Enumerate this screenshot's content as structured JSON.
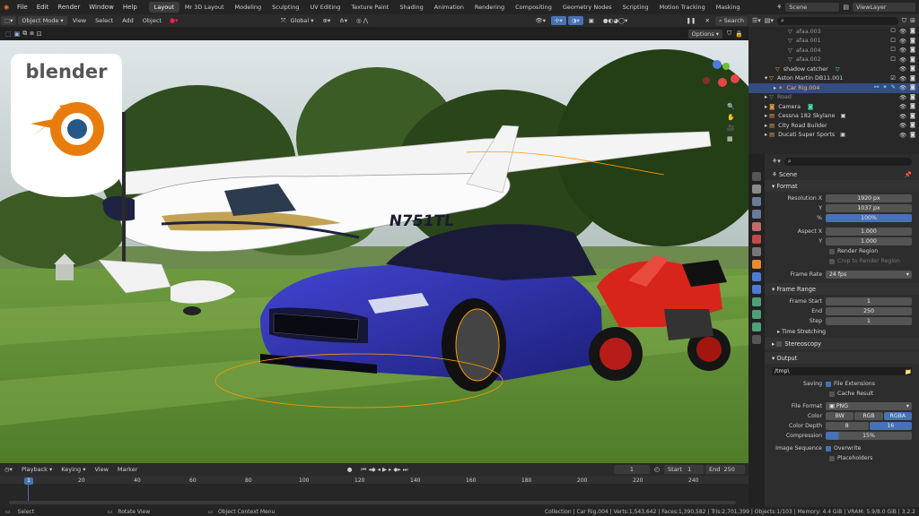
{
  "menubar": {
    "menus": [
      "File",
      "Edit",
      "Render",
      "Window",
      "Help"
    ],
    "workspaces": [
      "Layout",
      "Mr 3D Layout",
      "Modeling",
      "Sculpting",
      "UV Editing",
      "Texture Paint",
      "Shading",
      "Animation",
      "Rendering",
      "Compositing",
      "Geometry Nodes",
      "Scripting",
      "Motion Tracking",
      "Masking"
    ],
    "active_workspace": "Layout",
    "scene": "Scene",
    "view_layer": "ViewLayer"
  },
  "viewport_header": {
    "mode": "Object Mode",
    "menus": [
      "View",
      "Select",
      "Add",
      "Object"
    ],
    "transform": "Global",
    "search_label": "Search",
    "options": "Options"
  },
  "logo_text": "blender",
  "aircraft_registration": "N751TL",
  "outliner": {
    "rows": [
      {
        "label": "afaa.003",
        "indent": 3
      },
      {
        "label": "afaa.001",
        "indent": 3
      },
      {
        "label": "afaa.004",
        "indent": 3
      },
      {
        "label": "afaa.002",
        "indent": 3
      },
      {
        "label": "shadow catcher",
        "indent": 2
      },
      {
        "label": "Aston Martin DB11.001",
        "indent": 1
      },
      {
        "label": "Car Rig.004",
        "indent": 2,
        "selected": true
      },
      {
        "label": "Road",
        "indent": 1
      },
      {
        "label": "Camera",
        "indent": 1
      },
      {
        "label": "Cessna 182 Skylane",
        "indent": 1
      },
      {
        "label": "City Road Builder",
        "indent": 1
      },
      {
        "label": "Ducati Super Sports",
        "indent": 1
      }
    ]
  },
  "properties": {
    "scene_label": "Scene",
    "format": {
      "title": "Format",
      "resolution_x_label": "Resolution X",
      "resolution_x": "1920 px",
      "y_label": "Y",
      "resolution_y": "1037 px",
      "pct_label": "%",
      "pct": "100%",
      "aspect_x_label": "Aspect X",
      "aspect_x": "1.000",
      "aspect_y_label": "Y",
      "aspect_y": "1.000",
      "render_region": "Render Region",
      "crop": "Crop to Render Region",
      "frame_rate_label": "Frame Rate",
      "frame_rate": "24 fps"
    },
    "frame_range": {
      "title": "Frame Range",
      "start_label": "Frame Start",
      "start": "1",
      "end_label": "End",
      "end": "250",
      "step_label": "Step",
      "step": "1",
      "time_stretching": "Time Stretching"
    },
    "stereoscopy": "Stereoscopy",
    "output": {
      "title": "Output",
      "path": "/tmp\\",
      "saving_label": "Saving",
      "file_extensions": "File Extensions",
      "cache_result": "Cache Result",
      "file_format_label": "File Format",
      "file_format": "PNG",
      "color_label": "Color",
      "color_options": [
        "BW",
        "RGB",
        "RGBA"
      ],
      "color_selected": "RGBA",
      "depth_label": "Color Depth",
      "depth_options": [
        "8",
        "16"
      ],
      "depth_selected": "16",
      "compression_label": "Compression",
      "compression": "15%",
      "image_sequence_label": "Image Sequence",
      "overwrite": "Overwrite",
      "placeholders": "Placeholders"
    }
  },
  "timeline": {
    "menus": [
      "Playback",
      "Keying",
      "View",
      "Marker"
    ],
    "current_frame": "1",
    "start_label": "Start",
    "start": "1",
    "end_label": "End",
    "end": "250",
    "ticks": [
      "1",
      "20",
      "40",
      "60",
      "80",
      "100",
      "120",
      "140",
      "160",
      "180",
      "200",
      "220",
      "240"
    ]
  },
  "statusbar": {
    "left": [
      "Select",
      "Rotate View",
      "Object Context Menu"
    ],
    "right": "Collection | Car Rig.004 | Verts:1,543,642 | Faces:1,390,582 | Tris:2,701,399 | Objects:1/103 | Memory: 4.4 GiB | VRAM: 5.9/8.0 GiB | 3.2.2"
  },
  "colors": {
    "accent": "#4772b3",
    "logo_orange": "#e87d0d",
    "logo_blue": "#265787",
    "car_blue": "#2d2fb0",
    "bike_red": "#d8251c",
    "selection": "#ff9a00"
  }
}
